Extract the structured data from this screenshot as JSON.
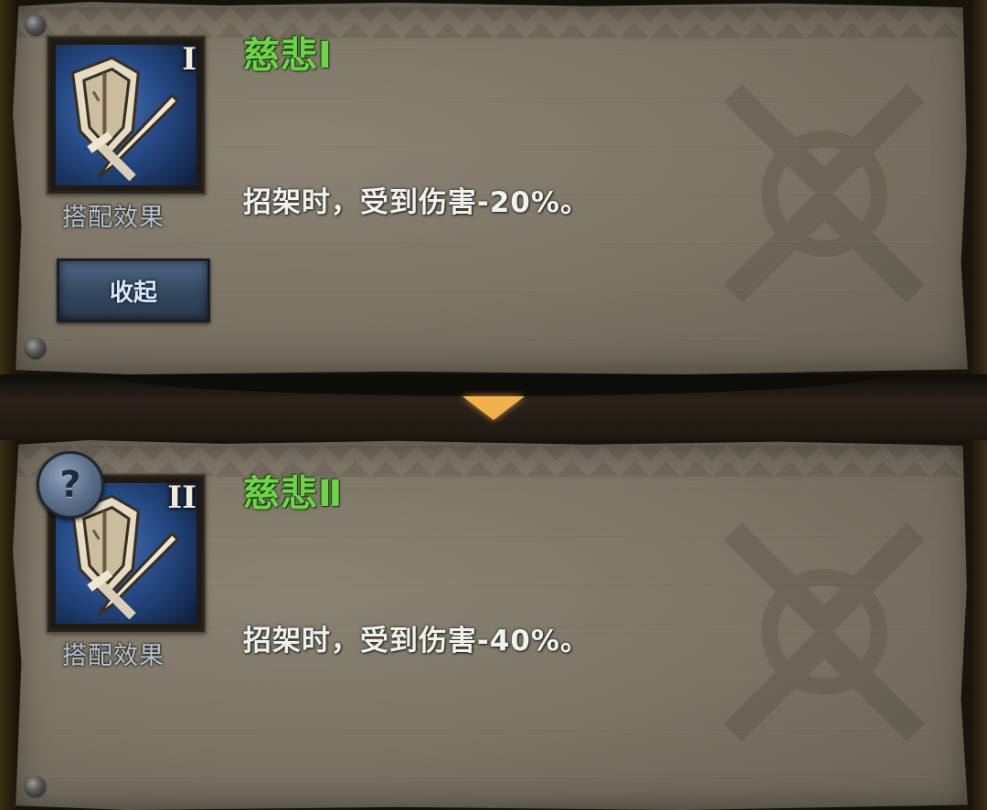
{
  "sets": [
    {
      "title": "慈悲Ⅰ",
      "tier_numeral": "I",
      "icon": "shield-sword-icon",
      "caption": "搭配效果",
      "effect": "招架时，受到伤害-20%。",
      "collapse_label": "收起"
    },
    {
      "title": "慈悲Ⅱ",
      "tier_numeral": "II",
      "icon": "shield-sword-icon",
      "caption": "搭配效果",
      "effect": "招架时，受到伤害-40%。",
      "help_label": "?"
    }
  ],
  "divider_icon": "expand-arrow-icon",
  "colors": {
    "title_green": "#6fd34a",
    "effect_text": "#f1f1ee",
    "button_blue": "#3f5472",
    "arrow_orange": "#f2b24a"
  }
}
